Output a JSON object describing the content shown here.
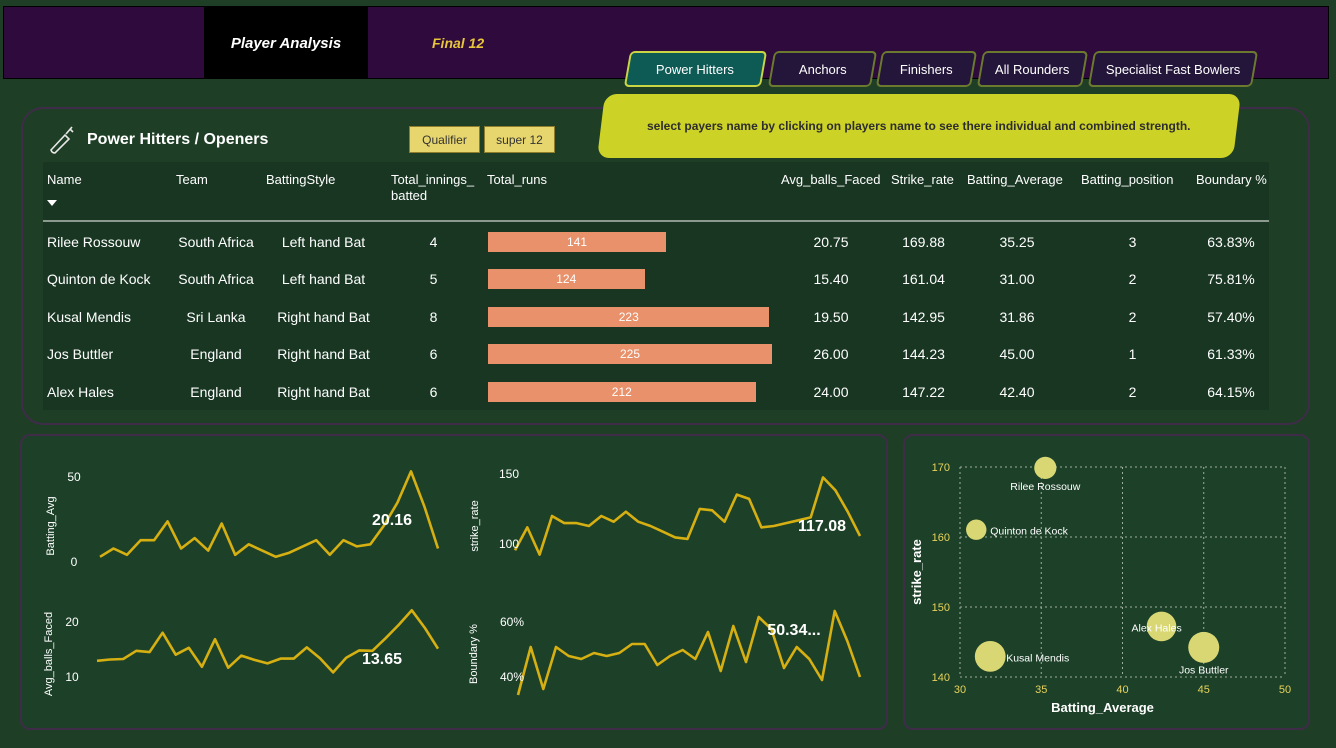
{
  "nav": {
    "player_analysis": "Player Analysis",
    "final": "Final 12"
  },
  "tabs": [
    {
      "label": "Power Hitters",
      "active": true
    },
    {
      "label": "Anchors",
      "active": false
    },
    {
      "label": "Finishers",
      "active": false
    },
    {
      "label": "All Rounders",
      "active": false
    },
    {
      "label": "Specialist Fast Bowlers",
      "active": false
    }
  ],
  "panel": {
    "title": "Power Hitters / Openers",
    "icon": "cricket-bat-icon",
    "filters": [
      "Qualifier",
      "super 12"
    ],
    "banner": "select payers name by clicking on players name to see there individual and combined strength."
  },
  "table": {
    "headers": {
      "name": "Name",
      "team": "Team",
      "style": "BattingStyle",
      "innings_1": "Total_innings_",
      "innings_2": "batted",
      "runs": "Total_runs",
      "avg_balls": "Avg_balls_Faced",
      "strike": "Strike_rate",
      "bat_avg": "Batting_Average",
      "position": "Batting_position",
      "boundary": "Boundary %"
    },
    "bar_color": "#e8916a",
    "runs_max": 225,
    "rows": [
      {
        "name": "Rilee Rossouw",
        "team": "South Africa",
        "style": "Left hand Bat",
        "innings": "4",
        "runs": "141",
        "avg_balls": "20.75",
        "strike": "169.88",
        "bat_avg": "35.25",
        "position": "3",
        "boundary": "63.83%"
      },
      {
        "name": "Quinton de Kock",
        "team": "South Africa",
        "style": "Left hand Bat",
        "innings": "5",
        "runs": "124",
        "avg_balls": "15.40",
        "strike": "161.04",
        "bat_avg": "31.00",
        "position": "2",
        "boundary": "75.81%"
      },
      {
        "name": "Kusal Mendis",
        "team": "Sri Lanka",
        "style": "Right hand Bat",
        "innings": "8",
        "runs": "223",
        "avg_balls": "19.50",
        "strike": "142.95",
        "bat_avg": "31.86",
        "position": "2",
        "boundary": "57.40%"
      },
      {
        "name": "Jos Buttler",
        "team": "England",
        "style": "Right hand Bat",
        "innings": "6",
        "runs": "225",
        "avg_balls": "26.00",
        "strike": "144.23",
        "bat_avg": "45.00",
        "position": "1",
        "boundary": "61.33%"
      },
      {
        "name": "Alex Hales",
        "team": "England",
        "style": "Right hand Bat",
        "innings": "6",
        "runs": "212",
        "avg_balls": "24.00",
        "strike": "147.22",
        "bat_avg": "42.40",
        "position": "2",
        "boundary": "64.15%"
      }
    ]
  },
  "chart_data": [
    {
      "type": "line",
      "ylabel": "Batting_Avg",
      "ticks": [
        "50",
        "0"
      ],
      "ylim": [
        0,
        60
      ],
      "callout": "20.16",
      "color": "#d6b012",
      "values": [
        14,
        18,
        15,
        22,
        22,
        31,
        18,
        23,
        17,
        30,
        15,
        20,
        17,
        14,
        16,
        19,
        22,
        15,
        22,
        19,
        20,
        29,
        40,
        55,
        38,
        18
      ]
    },
    {
      "type": "line",
      "ylabel": "strike_rate",
      "ticks": [
        "150",
        "100"
      ],
      "ylim": [
        90,
        160
      ],
      "callout": "117.08",
      "color": "#d6b012",
      "values": [
        101,
        117,
        98,
        125,
        120,
        120,
        118,
        125,
        121,
        128,
        121,
        118,
        114,
        110,
        109,
        130,
        129,
        121,
        140,
        137,
        117,
        118,
        120,
        122,
        124,
        152,
        143,
        128,
        111
      ]
    },
    {
      "type": "line",
      "ylabel": "Avg_balls_Faced",
      "ticks": [
        "20",
        "10"
      ],
      "ylim": [
        5,
        27
      ],
      "callout": "13.65",
      "color": "#d6b012",
      "values": [
        12,
        12.3,
        12.4,
        14.3,
        14,
        18.5,
        13.4,
        15,
        10.6,
        17,
        10.4,
        13.2,
        12.2,
        11.4,
        12.5,
        12.5,
        15.1,
        12.6,
        9.3,
        12.7,
        14.4,
        14.3,
        17.2,
        20.3,
        23.7,
        19.6,
        14.8
      ]
    },
    {
      "type": "line",
      "ylabel": "Boundary %",
      "ticks": [
        "60%",
        "40%"
      ],
      "ylim": [
        35,
        70
      ],
      "callout": "50.34...",
      "color": "#d6b012",
      "values": [
        37,
        53,
        39,
        53,
        50,
        49,
        51,
        50,
        51,
        54,
        54,
        47,
        50,
        52,
        49,
        58,
        45,
        60,
        48,
        63,
        59,
        46,
        53,
        49,
        42,
        65,
        55,
        43
      ]
    },
    {
      "type": "scatter",
      "xlabel": "Batting_Average",
      "ylabel": "strike_rate",
      "xlim": [
        30,
        50
      ],
      "ylim": [
        140,
        170
      ],
      "xticks": [
        "30",
        "35",
        "40",
        "45",
        "50"
      ],
      "yticks": [
        "170",
        "160",
        "150",
        "140"
      ],
      "color": "#d8d774",
      "points": [
        {
          "label": "Rilee Rossouw",
          "x": 35.25,
          "y": 169.88,
          "runs": 141
        },
        {
          "label": "Quinton de Kock",
          "x": 31.0,
          "y": 161.04,
          "runs": 124
        },
        {
          "label": "Kusal Mendis",
          "x": 31.86,
          "y": 142.95,
          "runs": 223
        },
        {
          "label": "Alex Hales",
          "x": 42.4,
          "y": 147.22,
          "runs": 212
        },
        {
          "label": "Jos Buttler",
          "x": 45.0,
          "y": 144.23,
          "runs": 225
        }
      ]
    }
  ]
}
